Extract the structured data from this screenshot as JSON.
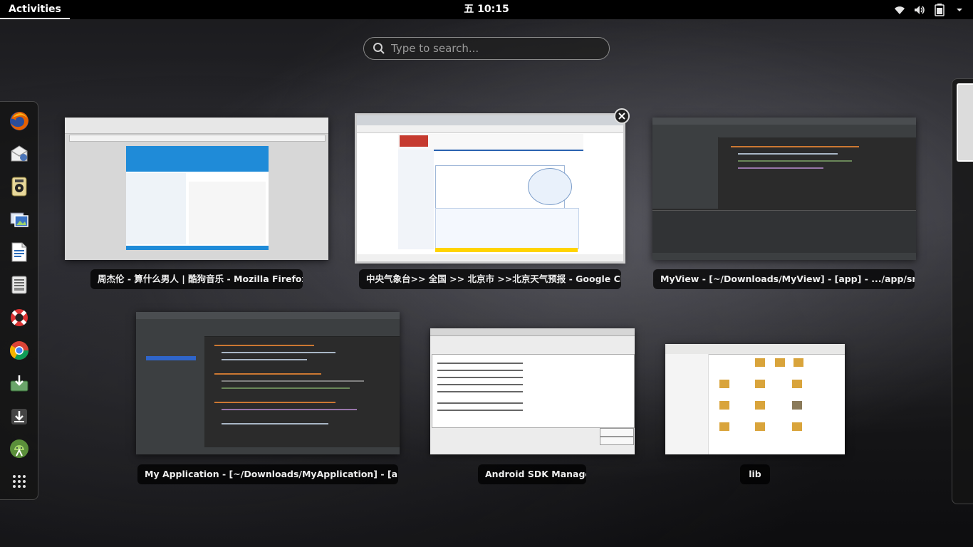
{
  "topbar": {
    "activities_label": "Activities",
    "clock": "五 10:15"
  },
  "tray_icons": [
    "wifi-icon",
    "volume-icon",
    "battery-icon"
  ],
  "search": {
    "placeholder": "Type to search..."
  },
  "dash": {
    "apps": [
      "firefox-icon",
      "thunderbird-mail-icon",
      "rhythmbox-music-icon",
      "shotwell-photos-icon",
      "libreoffice-writer-icon",
      "documents-icon",
      "help-lifebuoy-icon",
      "chrome-icon",
      "downloads-icon",
      "android-sdk-download-icon",
      "android-studio-icon",
      "show-apps-grid-icon"
    ]
  },
  "windows": [
    {
      "title": "周杰伦 - 算什么男人 | 酷狗音乐 - Mozilla Firefox"
    },
    {
      "title": "中央气象台>> 全国 >> 北京市 >>北京天气预报 - Google Ch..."
    },
    {
      "title": "MyView - [~/Downloads/MyView] - [app] - .../app/src/main/..."
    },
    {
      "title": "My Application - [~/Downloads/MyApplication] - [app] - .../..."
    },
    {
      "title": "Android SDK Manager"
    },
    {
      "title": "lib"
    }
  ],
  "colors": {
    "topbar_bg": "#000000",
    "caption_bg": "#000000",
    "firefox_orange": "#e66000",
    "chrome_red": "#db4437",
    "android_green": "#8bc34a"
  }
}
